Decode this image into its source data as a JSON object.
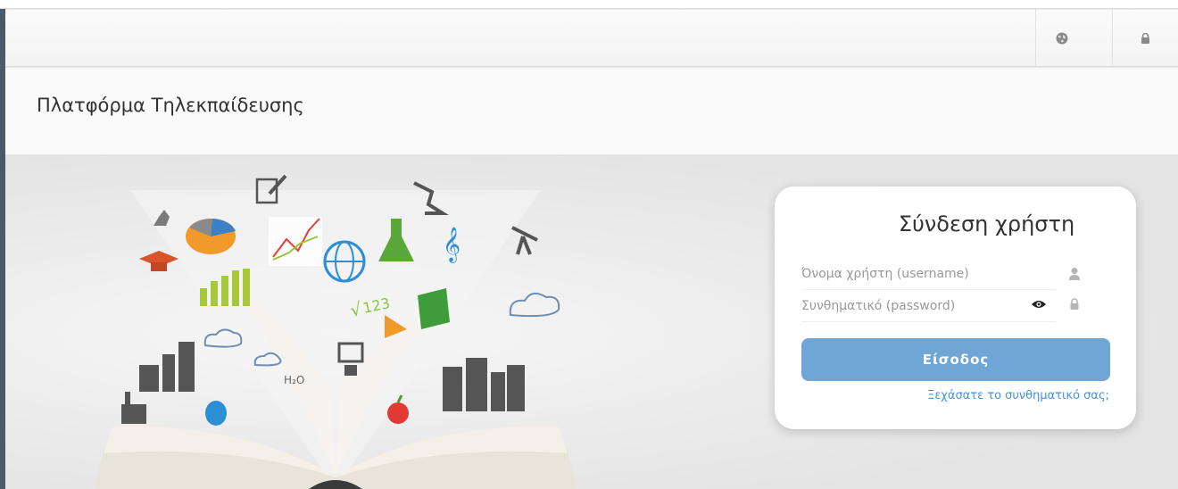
{
  "header": {
    "language_icon": "globe-icon",
    "lock_icon": "lock-icon"
  },
  "page": {
    "title": "Πλατφόρμα Τηλεκπαίδευσης"
  },
  "login": {
    "title": "Σύνδεση χρήστη",
    "username_placeholder": "Όνομα χρήστη (username)",
    "password_placeholder": "Συνθηματικό (password)",
    "submit_label": "Είσοδος",
    "forgot_label": "Ξεχάσατε το συνθηματικό σας;",
    "icons": [
      "user-icon",
      "eye-icon",
      "lock-icon"
    ]
  },
  "hero": {
    "illustration": "open-book-education-illustration",
    "text_123": "123",
    "text_h2o": "H₂O"
  },
  "colors": {
    "button": "#6fa6d6",
    "link": "#4a90d9",
    "text": "#333333"
  }
}
